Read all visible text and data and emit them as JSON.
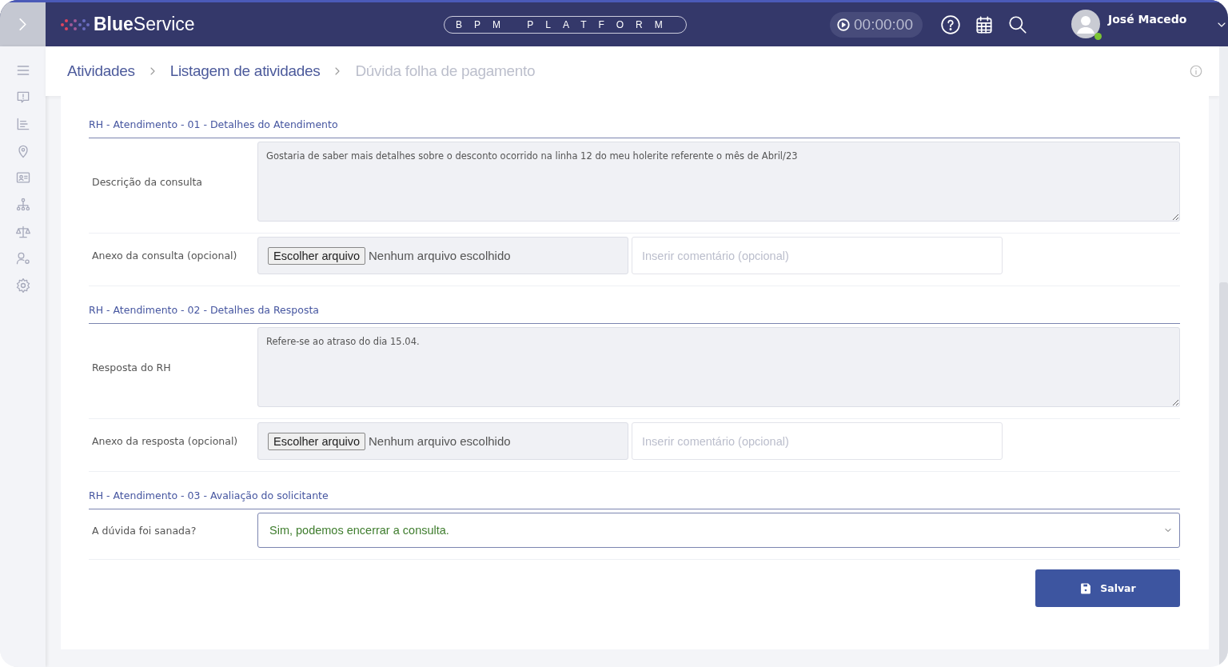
{
  "header": {
    "brand_bold": "Blue",
    "brand_light": "Service",
    "platform": "BPM PLATFORM",
    "timer": "00:00:00",
    "user": "José Macedo",
    "user_online": true
  },
  "breadcrumb": [
    {
      "label": "Atividades",
      "current": false
    },
    {
      "label": "Listagem de atividades",
      "current": false
    },
    {
      "label": "Dúvida folha de pagamento",
      "current": true
    }
  ],
  "sections": [
    {
      "title": "RH - Atendimento - 01 - Detalhes do Atendimento",
      "rows": [
        {
          "kind": "textarea",
          "label": "Descrição da consulta",
          "value": "Gostaria de saber mais detalhes sobre o desconto ocorrido na linha 12 do meu holerite referente o mês de Abril/23"
        },
        {
          "kind": "file",
          "label": "Anexo da consulta (opcional)",
          "button": "Escolher arquivo",
          "status": "Nenhum arquivo escolhido",
          "placeholder": "Inserir comentário (opcional)"
        }
      ]
    },
    {
      "title": "RH - Atendimento - 02 - Detalhes da Resposta",
      "rows": [
        {
          "kind": "textarea",
          "label": "Resposta do RH",
          "value": "Refere-se ao atraso do dia 15.04."
        },
        {
          "kind": "file",
          "label": "Anexo da resposta (opcional)",
          "button": "Escolher arquivo",
          "status": "Nenhum arquivo escolhido",
          "placeholder": "Inserir comentário (opcional)"
        }
      ]
    },
    {
      "title": "RH - Atendimento - 03 - Avaliação do solicitante",
      "rows": [
        {
          "kind": "select",
          "label": "A dúvida foi sanada?",
          "value": "Sim, podemos encerrar a consulta."
        }
      ]
    }
  ],
  "save_button": "Salvar"
}
